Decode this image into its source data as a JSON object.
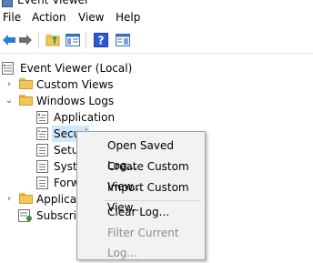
{
  "window": {
    "title": "Event Viewer"
  },
  "menu": [
    {
      "label": "File"
    },
    {
      "label": "Action"
    },
    {
      "label": "View"
    },
    {
      "label": "Help"
    }
  ],
  "toolbar": {
    "buttons": [
      {
        "icon": "back-arrow-icon",
        "color": "#2a7fd4"
      },
      {
        "icon": "forward-arrow-icon",
        "color": "#6d6d6d"
      },
      {
        "icon": "up-folder-icon",
        "color": "#e8b64a"
      },
      {
        "icon": "show-hide-tree-icon",
        "color": "#3a6fb0"
      },
      {
        "icon": "help-icon",
        "color": "#2a5bd7"
      },
      {
        "icon": "properties-icon",
        "color": "#3a6fb0"
      }
    ]
  },
  "tree": {
    "root": {
      "label": "Event Viewer (Local)",
      "expanded": true
    },
    "custom_views": {
      "label": "Custom Views",
      "expanded": false
    },
    "windows_logs": {
      "label": "Windows Logs",
      "expanded": true,
      "children": [
        {
          "label": "Application"
        },
        {
          "label": "Security",
          "selected": true
        },
        {
          "label": "Setup"
        },
        {
          "label": "System"
        },
        {
          "label": "Forwarded Events"
        }
      ]
    },
    "applications_services": {
      "label": "Applications and Services Logs",
      "expanded": false
    },
    "subscriptions": {
      "label": "Subscriptions"
    }
  },
  "visible_labels": {
    "security": "Securi",
    "setup": "Setu",
    "system": "Syste",
    "forwarded": "Forw",
    "applications": "Applicat"
  },
  "context_menu": {
    "items": [
      {
        "label": "Open Saved Log...",
        "disabled": false
      },
      {
        "label": "Create Custom View...",
        "disabled": false
      },
      {
        "label": "Import Custom View...",
        "disabled": false
      },
      {
        "label": "Clear Log...",
        "disabled": false
      },
      {
        "label": "Filter Current Log...",
        "disabled": true,
        "highlighted": true
      }
    ]
  },
  "colors": {
    "selection": "#cce8ff",
    "menu_bg": "#f2f2f2",
    "disabled_text": "#8c8c8c",
    "highlight": "#fafaaa"
  }
}
